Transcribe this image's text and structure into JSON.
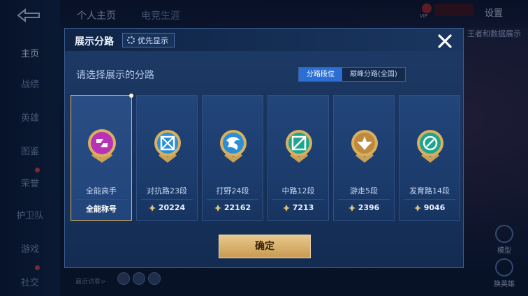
{
  "background": {
    "sidebar_items": [
      "主页",
      "战绩",
      "英雄",
      "图鉴",
      "荣誉",
      "护卫队",
      "游戏",
      "社交"
    ],
    "top_tabs": [
      "个人主页",
      "电竞生涯"
    ],
    "settings_label": "设置",
    "right_label": "王者和数据展示",
    "model_label": "模型",
    "switch_hero_label": "换英雄",
    "visitors_label": "最近访客>"
  },
  "modal": {
    "title": "展示分路",
    "priority_label": "优先显示",
    "subtitle": "请选择展示的分路",
    "toggle": {
      "options": [
        "分路段位",
        "巅峰分路(全国)"
      ],
      "active_index": 0
    },
    "lanes": [
      {
        "name": "全能高手",
        "score": "全能称号",
        "badge_color": "#b832b8",
        "badge_symbol": "all-round-icon",
        "selected": true
      },
      {
        "name": "对抗路23段",
        "score": "20224",
        "badge_color": "#2a8fd4",
        "badge_symbol": "clash-lane-icon",
        "selected": false
      },
      {
        "name": "打野24段",
        "score": "22162",
        "badge_color": "#2a8fd4",
        "badge_symbol": "jungle-icon",
        "selected": false
      },
      {
        "name": "中路12段",
        "score": "7213",
        "badge_color": "#1fa58e",
        "badge_symbol": "mid-lane-icon",
        "selected": false
      },
      {
        "name": "游走5段",
        "score": "2396",
        "badge_color": "#c08a3c",
        "badge_symbol": "roam-icon",
        "selected": false
      },
      {
        "name": "发育路14段",
        "score": "9046",
        "badge_color": "#1fa58e",
        "badge_symbol": "farm-lane-icon",
        "selected": false
      }
    ],
    "confirm_label": "确定"
  }
}
